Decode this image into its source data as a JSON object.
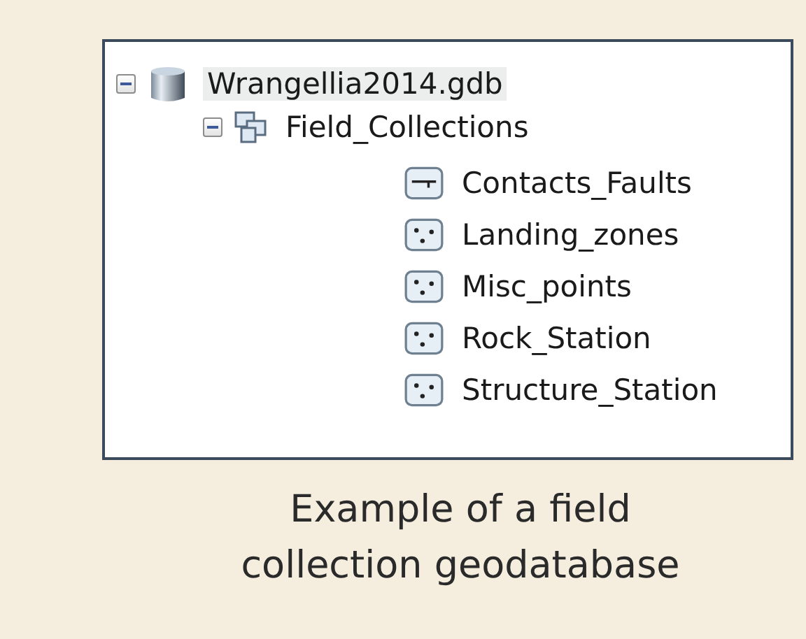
{
  "tree": [
    {
      "label": "Wrangellia2014.gdb",
      "kind": "database",
      "expanded": true,
      "selected": true,
      "children": [
        {
          "label": "Field_Collections",
          "kind": "dataset",
          "expanded": true,
          "selected": false,
          "children": [
            {
              "label": "Contacts_Faults",
              "kind": "line",
              "selected": false
            },
            {
              "label": "Landing_zones",
              "kind": "point",
              "selected": false
            },
            {
              "label": "Misc_points",
              "kind": "point",
              "selected": false
            },
            {
              "label": "Rock_Station",
              "kind": "point",
              "selected": false
            },
            {
              "label": "Structure_Station",
              "kind": "point",
              "selected": false
            }
          ]
        }
      ]
    }
  ],
  "caption": [
    "Example of a field",
    "collection geodatabase"
  ]
}
